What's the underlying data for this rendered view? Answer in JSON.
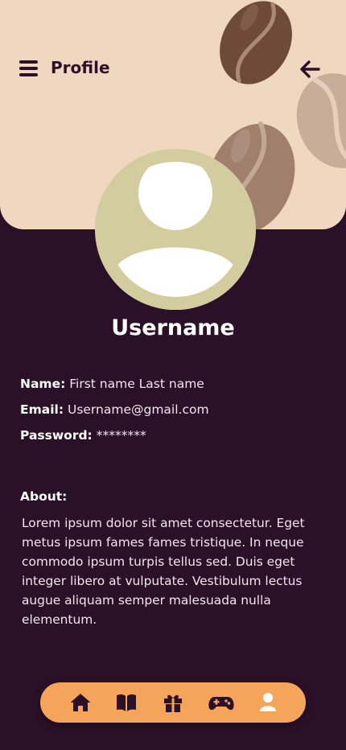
{
  "header": {
    "title": "Profile",
    "menu_icon": "hamburger-menu-icon",
    "back_icon": "arrow-left-icon",
    "background_color": "#efd8bf",
    "decoration": "coffee-beans"
  },
  "profile": {
    "avatar_icon": "user-avatar-placeholder",
    "username": "Username",
    "fields": [
      {
        "label": "Name:",
        "value": "First name Last name"
      },
      {
        "label": "Email:",
        "value": "Username@gmail.com"
      },
      {
        "label": "Password:",
        "value": "********"
      }
    ],
    "about_label": "About:",
    "about_text": "Lorem ipsum dolor sit amet consectetur. Eget metus ipsum fames fames tristique. In neque commodo ipsum turpis tellus sed. Duis eget integer libero at vulputate. Vestibulum lectus augue aliquam semper malesuada nulla elementum."
  },
  "bottom_nav": {
    "items": [
      {
        "icon": "home-icon"
      },
      {
        "icon": "book-icon"
      },
      {
        "icon": "gift-icon"
      },
      {
        "icon": "gamepad-icon"
      },
      {
        "icon": "user-icon"
      }
    ],
    "background_color": "#f4a55a"
  },
  "colors": {
    "background": "#2b1128",
    "accent": "#f4a55a",
    "avatar_bg": "#d3cc9f"
  }
}
